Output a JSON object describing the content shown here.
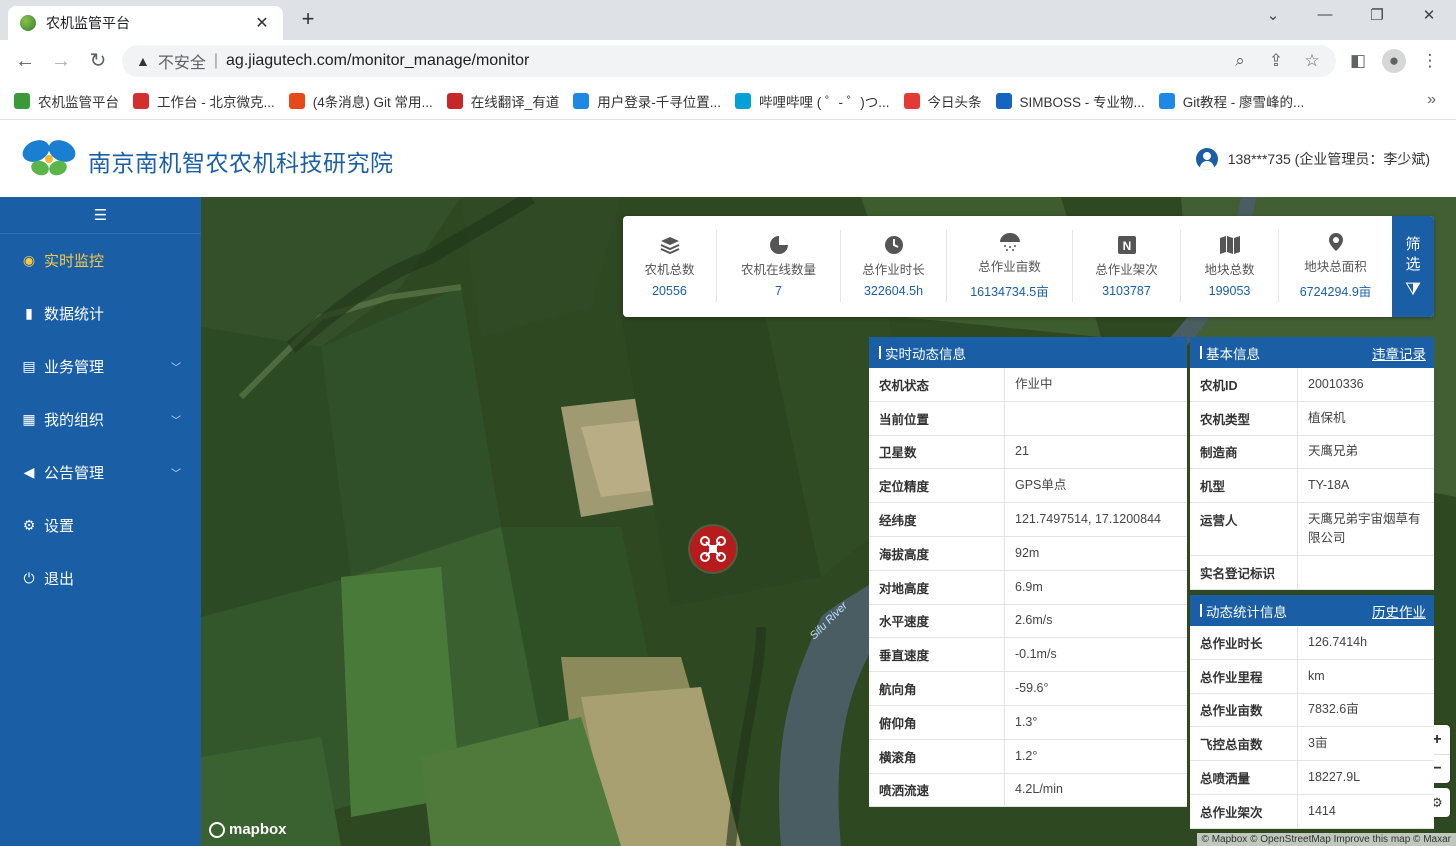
{
  "browser": {
    "tab_title": "农机监管平台",
    "address": {
      "warning": "不安全",
      "url": "ag.jiagutech.com/monitor_manage/monitor"
    },
    "bookmarks": [
      {
        "label": "农机监管平台",
        "color": "#3a9a3a"
      },
      {
        "label": "工作台 - 北京微克...",
        "color": "#d32f2f"
      },
      {
        "label": "(4条消息) Git 常用...",
        "color": "#e64a19"
      },
      {
        "label": "在线翻译_有道",
        "color": "#c62828"
      },
      {
        "label": "用户登录-千寻位置...",
        "color": "#1e88e5"
      },
      {
        "label": "哔哩哔哩 ( ゜- ゜)つ...",
        "color": "#00a1d6"
      },
      {
        "label": "今日头条",
        "color": "#e53935"
      },
      {
        "label": "SIMBOSS - 专业物...",
        "color": "#1565c0"
      },
      {
        "label": "Git教程 - 廖雪峰的...",
        "color": "#1e88e5"
      }
    ],
    "more": "»"
  },
  "header": {
    "title": "南京南机智农农机科技研究院",
    "user": "138***735 (企业管理员：李少斌)"
  },
  "sidebar": {
    "items": [
      {
        "label": "实时监控",
        "icon": "location-icon",
        "active": true,
        "sub": false
      },
      {
        "label": "数据统计",
        "icon": "bar-chart-icon",
        "active": false,
        "sub": false
      },
      {
        "label": "业务管理",
        "icon": "list-icon",
        "active": false,
        "sub": true
      },
      {
        "label": "我的组织",
        "icon": "building-icon",
        "active": false,
        "sub": true
      },
      {
        "label": "公告管理",
        "icon": "speaker-icon",
        "active": false,
        "sub": true
      },
      {
        "label": "设置",
        "icon": "gear-icon",
        "active": false,
        "sub": false
      },
      {
        "label": "退出",
        "icon": "power-icon",
        "active": false,
        "sub": false
      }
    ]
  },
  "stats": {
    "items": [
      {
        "label": "农机总数",
        "value": "20556",
        "icon": "layers-icon"
      },
      {
        "label": "农机在线数量",
        "value": "7",
        "icon": "pie-icon"
      },
      {
        "label": "总作业时长",
        "value": "322604.5h",
        "icon": "clock-icon"
      },
      {
        "label": "总作业亩数",
        "value": "16134734.5亩",
        "icon": "umbrella-icon"
      },
      {
        "label": "总作业架次",
        "value": "3103787",
        "icon": "n-badge-icon"
      },
      {
        "label": "地块总数",
        "value": "199053",
        "icon": "map-icon"
      },
      {
        "label": "地块总面积",
        "value": "6724294.9亩",
        "icon": "pin-icon"
      }
    ],
    "filter_label_1": "筛",
    "filter_label_2": "选"
  },
  "realtime": {
    "title": "实时动态信息",
    "rows": [
      {
        "k": "农机状态",
        "v": "作业中"
      },
      {
        "k": "当前位置",
        "v": ""
      },
      {
        "k": "卫星数",
        "v": "21"
      },
      {
        "k": "定位精度",
        "v": "GPS单点"
      },
      {
        "k": "经纬度",
        "v": "121.7497514, 17.1200844"
      },
      {
        "k": "海拔高度",
        "v": "92m"
      },
      {
        "k": "对地高度",
        "v": "6.9m"
      },
      {
        "k": "水平速度",
        "v": "2.6m/s"
      },
      {
        "k": "垂直速度",
        "v": "-0.1m/s"
      },
      {
        "k": "航向角",
        "v": "-59.6°"
      },
      {
        "k": "俯仰角",
        "v": "1.3°"
      },
      {
        "k": "横滚角",
        "v": "1.2°"
      },
      {
        "k": "喷洒流速",
        "v": "4.2L/min"
      }
    ]
  },
  "basic": {
    "title": "基本信息",
    "link": "违章记录",
    "rows": [
      {
        "k": "农机ID",
        "v": "20010336"
      },
      {
        "k": "农机类型",
        "v": "植保机"
      },
      {
        "k": "制造商",
        "v": "天鹰兄弟"
      },
      {
        "k": "机型",
        "v": "TY-18A"
      },
      {
        "k": "运营人",
        "v": "天鹰兄弟宇宙烟草有限公司"
      },
      {
        "k": "实名登记标识",
        "v": ""
      }
    ]
  },
  "dynamic": {
    "title": "动态统计信息",
    "link": "历史作业",
    "rows": [
      {
        "k": "总作业时长",
        "v": "126.7414h"
      },
      {
        "k": "总作业里程",
        "v": "km"
      },
      {
        "k": "总作业亩数",
        "v": "7832.6亩"
      },
      {
        "k": "飞控总亩数",
        "v": "3亩"
      },
      {
        "k": "总喷洒量",
        "v": "18227.9L"
      },
      {
        "k": "总作业架次",
        "v": "1414"
      }
    ]
  },
  "map": {
    "brand": "mapbox",
    "attribution": "© Mapbox © OpenStreetMap Improve this map © Maxar",
    "river_label": "Sifu River",
    "zoom_in": "+",
    "zoom_out": "−"
  }
}
